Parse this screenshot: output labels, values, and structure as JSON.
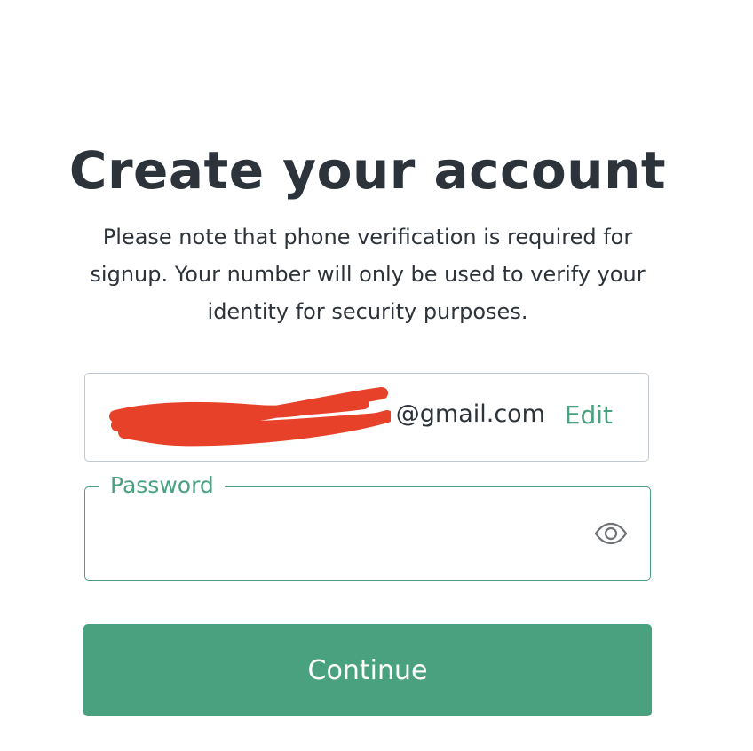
{
  "header": {
    "title": "Create your account",
    "subtitle": "Please note that phone verification is required for signup. Your number will only be used to verify your identity for security purposes."
  },
  "email": {
    "visible_value": "@gmail.com",
    "edit_label": "Edit",
    "redacted": true
  },
  "password": {
    "label": "Password",
    "value": "",
    "toggle_icon": "eye-icon"
  },
  "actions": {
    "continue_label": "Continue"
  },
  "colors": {
    "accent": "#4aa17f",
    "text": "#2d333a",
    "border": "#c2c8d0",
    "redaction": "#e8412a"
  }
}
